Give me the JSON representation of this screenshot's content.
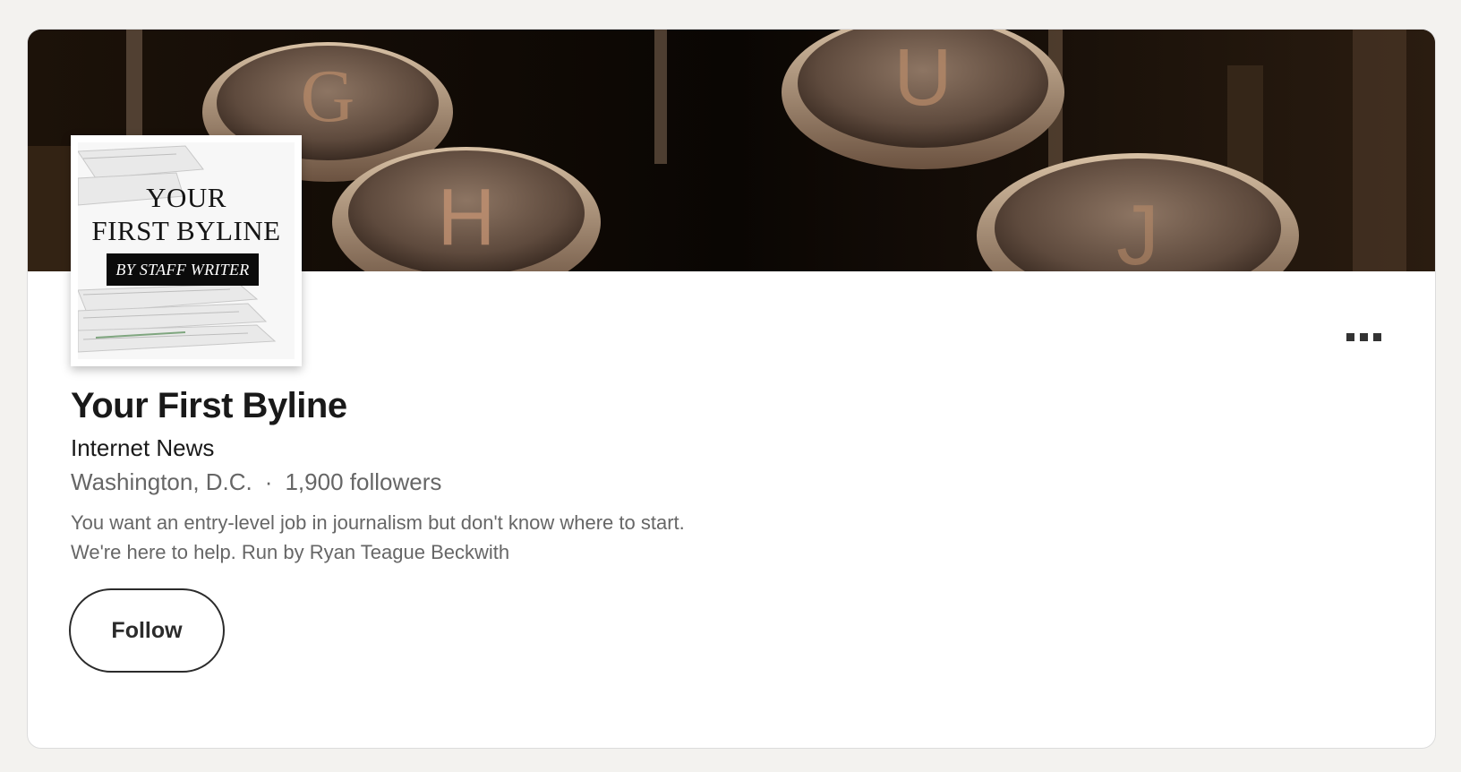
{
  "company": {
    "name": "Your First Byline",
    "industry": "Internet News",
    "location": "Washington, D.C.",
    "separator": "·",
    "followers": "1,900 followers",
    "description_line1": "You want an entry-level job in journalism but don't know where to start.",
    "description_line2": "We're here to help. Run by Ryan Teague Beckwith"
  },
  "logo": {
    "line1": "YOUR",
    "line2": "FIRST BYLINE",
    "banner": "BY STAFF WRITER"
  },
  "actions": {
    "follow_label": "Follow",
    "more_icon": "ellipsis-icon"
  },
  "cover": {
    "key_letters": [
      "G",
      "U",
      "H",
      "J"
    ]
  },
  "colors": {
    "card_background": "#ffffff",
    "page_background": "#f3f2ef",
    "title_text": "#191919",
    "secondary_text": "#666666",
    "button_border": "#2b2b2b"
  }
}
